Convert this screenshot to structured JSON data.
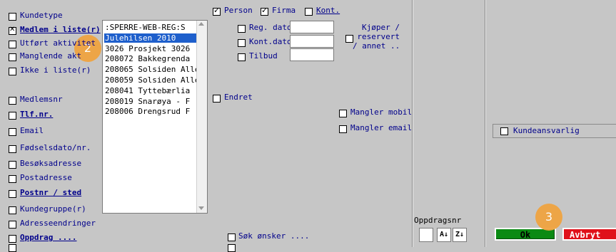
{
  "left_col": [
    {
      "label": "Kundetype",
      "style": "ul-part",
      "checked": false
    },
    {
      "label": "Medlem i liste(r)",
      "style": "bold",
      "checked": "crossed"
    },
    {
      "label": "Utført aktivitet",
      "style": "plain",
      "checked": false
    },
    {
      "label": "Manglende akt",
      "style": "plain",
      "checked": false
    },
    {
      "label": "Ikke i liste(r)",
      "style": "plain",
      "checked": false
    },
    {
      "label": "Medlemsnr",
      "style": "plain",
      "checked": false
    },
    {
      "label": "Tlf.nr.",
      "style": "bold",
      "checked": false
    },
    {
      "label": "Email",
      "style": "ul-part",
      "checked": false
    },
    {
      "label": "Fødselsdato/nr.",
      "style": "ul-part",
      "checked": false
    },
    {
      "label": "Besøksadresse",
      "style": "ul-part",
      "checked": false
    },
    {
      "label": "Postadresse",
      "style": "plain",
      "checked": false
    },
    {
      "label": "Postnr / sted",
      "style": "bold",
      "checked": false
    },
    {
      "label": "Kundegruppe(r)",
      "style": "plain",
      "checked": false
    },
    {
      "label": "Adresseendringer",
      "style": "plain",
      "checked": false
    },
    {
      "label": "Oppdrag ....",
      "style": "bold",
      "checked": false
    }
  ],
  "listbox": {
    "items": [
      ":SPERRE-WEB-REG:S",
      "Julehilsen 2010",
      "3026 Prosjekt 3026",
      "208072 Bakkegrenda",
      "208065 Solsiden Alle",
      "208059 Solsiden Alle",
      "208041 Tyttebærlia",
      "208019 Snarøya - F",
      "208006 Drengsrud F"
    ],
    "selected_index": 1
  },
  "top_row": {
    "person": "Person",
    "firma": "Firma",
    "kont": "Kont."
  },
  "mid_fields": [
    {
      "label": "Reg. dato"
    },
    {
      "label": "Kont.dato"
    },
    {
      "label": "Tilbud"
    }
  ],
  "kjoper": "Kjøper /\nreservert\n/ annet ..",
  "endret": "Endret",
  "mangler_mobil": "Mangler mobil",
  "mangler_email": "Mangler email",
  "kundeansvarlig": "Kundeansvarlig",
  "sok_onsker": "Søk ønsker ....",
  "oppdragsnr": "Oppdragsnr",
  "sort_icons": [
    "A→Z",
    "Z→A"
  ],
  "ok_label": "Ok",
  "avbryt_label": "Avbryt",
  "badges": [
    "2",
    "3"
  ],
  "colors": {
    "ok_bg": "#0b8a13",
    "avbryt_bg": "#e0111a",
    "badge": "#f0a441",
    "selection": "#1e5fcc",
    "label": "#00008b"
  }
}
